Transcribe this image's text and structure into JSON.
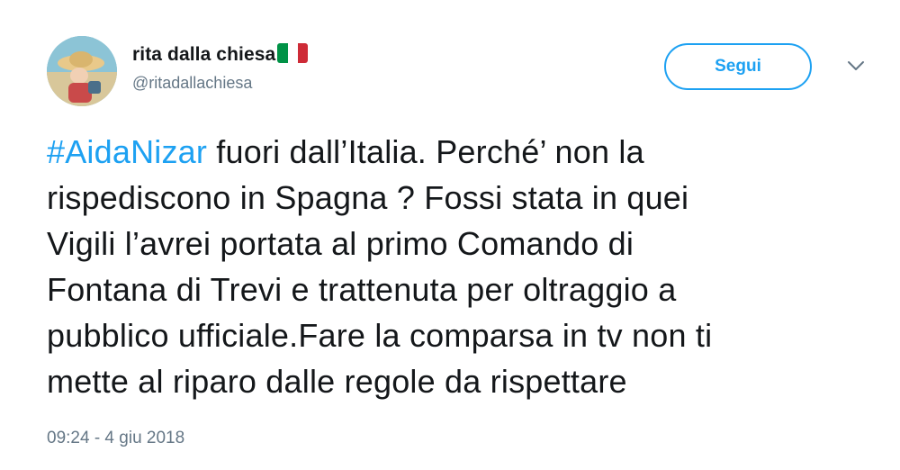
{
  "user": {
    "display_name": "rita dalla chiesa",
    "handle": "@ritadallachiesa",
    "flag_icon": "italy-flag-icon",
    "flag_colors": [
      "#009246",
      "#ffffff",
      "#ce2b37"
    ]
  },
  "follow_button": {
    "label": "Segui",
    "color": "#1da1f2"
  },
  "menu": {
    "icon": "chevron-down-icon"
  },
  "tweet": {
    "hashtag": "#AidaNizar",
    "lines": [
      " fuori dall’Italia. Perché’ non la",
      "rispediscono in Spagna ? Fossi stata in quei",
      "Vigili l’avrei portata al primo Comando di",
      "Fontana di Trevi e trattenuta per oltraggio a",
      "pubblico ufficiale.Fare la comparsa in tv non ti",
      "mette al riparo dalle regole da rispettare"
    ],
    "link_color": "#1da1f2"
  },
  "timestamp": "09:24 - 4 giu 2018"
}
